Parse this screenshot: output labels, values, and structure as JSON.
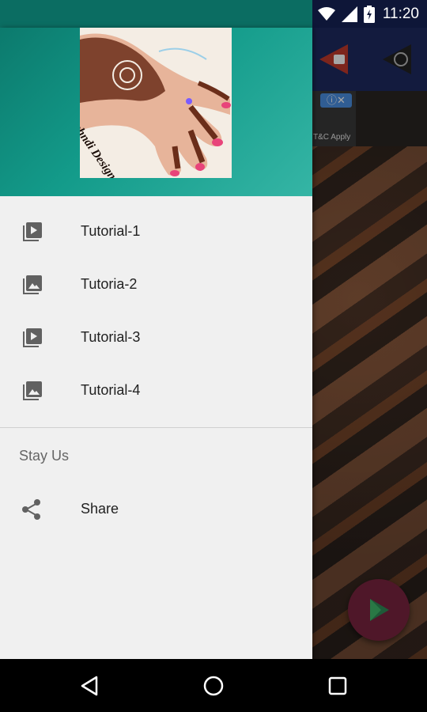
{
  "status_bar": {
    "time": "11:20",
    "icons": [
      "wifi-icon",
      "signal-icon",
      "battery-icon"
    ]
  },
  "drawer": {
    "header_image_text": "Mehndi Designs",
    "menu_items": [
      {
        "label": "Tutorial-1",
        "icon": "video-library-icon"
      },
      {
        "label": "Tutoria-2",
        "icon": "photo-library-icon"
      },
      {
        "label": "Tutorial-3",
        "icon": "video-library-icon"
      },
      {
        "label": "Tutorial-4",
        "icon": "photo-library-icon"
      }
    ],
    "section_header": "Stay Us",
    "share_item": {
      "label": "Share",
      "icon": "share-icon"
    }
  },
  "background": {
    "ad_text": "T&C Apply",
    "toolbar_icons": [
      "youtube-icon",
      "wordpress-icon"
    ],
    "fab_icon": "play-store-icon"
  },
  "nav_bar": {
    "buttons": [
      "back-button",
      "home-button",
      "recents-button"
    ]
  },
  "colors": {
    "drawer_header_start": "#0c7a6d",
    "drawer_header_end": "#35b5a5",
    "drawer_bg": "#f0f0f0",
    "text_primary": "#212121",
    "text_secondary": "#666666"
  }
}
